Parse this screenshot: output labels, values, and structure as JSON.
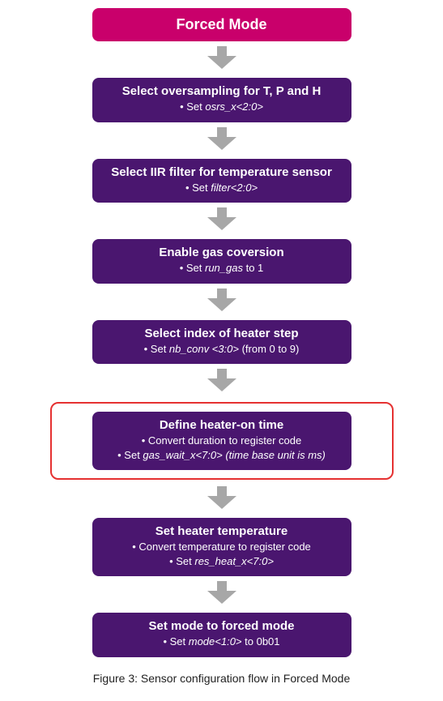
{
  "header": {
    "title": "Forced Mode"
  },
  "steps": {
    "s1": {
      "title": "Select oversampling for T, P and H",
      "l1_a": "• Set ",
      "l1_b": "osrs_x<2:0>"
    },
    "s2": {
      "title": "Select IIR filter for temperature sensor",
      "l1_a": "• Set ",
      "l1_b": "filter<2:0>"
    },
    "s3": {
      "title": "Enable gas coversion",
      "l1_a": "• Set ",
      "l1_b": "run_gas",
      "l1_c": " to 1"
    },
    "s4": {
      "title": "Select index of heater step",
      "l1_a": "• Set ",
      "l1_b": "nb_conv <3:0>",
      "l1_c": " (from 0 to 9)"
    },
    "s5": {
      "title": "Define heater-on time",
      "l1": "• Convert duration to register code",
      "l2_a": "• Set ",
      "l2_b": "gas_wait_x<7:0> (time base unit is ms)"
    },
    "s6": {
      "title": "Set heater temperature",
      "l1": "• Convert temperature to register code",
      "l2_a": "• Set ",
      "l2_b": "res_heat_x<7:0>"
    },
    "s7": {
      "title": "Set mode to forced mode",
      "l1_a": "• Set ",
      "l1_b": "mode<1:0>",
      "l1_c": " to 0b01"
    }
  },
  "caption": "Figure 3: Sensor configuration flow in Forced Mode",
  "colors": {
    "header": "#C9006B",
    "step": "#4A166F",
    "arrow": "#A7A7A7",
    "highlight": "#E53131"
  }
}
